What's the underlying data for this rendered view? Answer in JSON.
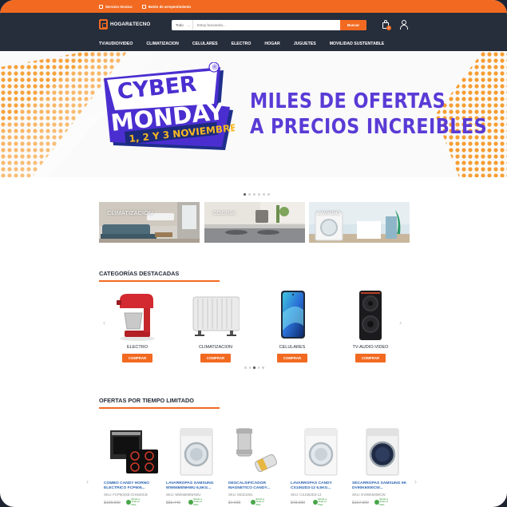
{
  "topbar": {
    "items": [
      {
        "icon": "wrench-icon",
        "label": "Servicio técnico"
      },
      {
        "icon": "return-icon",
        "label": "Botón de arrepentimiento"
      }
    ]
  },
  "header": {
    "logo_text": "HOGAR&TECNO",
    "search": {
      "category": "Todo",
      "placeholder": "Estoy buscando...",
      "button": "Buscar"
    },
    "cart_count": "0"
  },
  "nav": [
    "TV/AUDIO/VIDEO",
    "CLIMATIZACION",
    "CELULARES",
    "ELECTRO",
    "HOGAR",
    "JUGUETES",
    "MOVILIDAD SUSTENTABLE"
  ],
  "hero": {
    "badge_line1": "CYBER",
    "badge_line2": "MONDAY",
    "badge_dates": "1, 2 Y 3 NOVIEMBRE",
    "registered": "®",
    "headline_1": "MILES DE OFERTAS",
    "headline_2": "A PRECIOS INCREIBLES",
    "slides": 6,
    "active_slide": 0
  },
  "tiles": [
    {
      "label": "CLIMATIZACIÓN"
    },
    {
      "label": "COCINA"
    },
    {
      "label": "LAVADO"
    }
  ],
  "featured": {
    "title": "CATEGORÍAS DESTACADAS",
    "items": [
      {
        "name": "ELECTRO",
        "button": "COMPRAR"
      },
      {
        "name": "CLIMATIZACION",
        "button": "COMPRAR"
      },
      {
        "name": "CELULARES",
        "button": "COMPRAR"
      },
      {
        "name": "TV-AUDIO-VIDEO",
        "button": "COMPRAR"
      }
    ],
    "pages": 5,
    "active_page": 2
  },
  "offers": {
    "title": "OFERTAS POR TIEMPO LIMITADO",
    "items": [
      {
        "name": "COMBO CANDY HORNO ELECTRICO FCP605...",
        "sku": "SKU: FCP602XE-CHI640CB",
        "price": "$108.999"
      },
      {
        "name": "LAVARROPAS SAMSUNG WW65M0NHWU 6,5KG...",
        "sku": "SKU: WW65M0NHWU",
        "price": "$55.449"
      },
      {
        "name": "DESCALSIFICADOR MAGNETICO CANDY...",
        "sku": "SKU: MCD1001",
        "price": "$7.699"
      },
      {
        "name": "LAVARROPAS CANDY CS1062D3-12 6,5KG...",
        "sku": "SKU: CS1062D3-12",
        "price": "$48.999"
      },
      {
        "name": "SECARROPAS SAMSUNG 9K DV90K6000CW...",
        "sku": "SKU: DV90K6000CW",
        "price": "$107.999"
      }
    ],
    "shipping_label_1": "Envío a",
    "shipping_label_2": "Todo el País"
  },
  "colors": {
    "accent": "#f26a21",
    "header": "#262d3b",
    "hero_text": "#5a3bd6",
    "link": "#2a64b5"
  }
}
